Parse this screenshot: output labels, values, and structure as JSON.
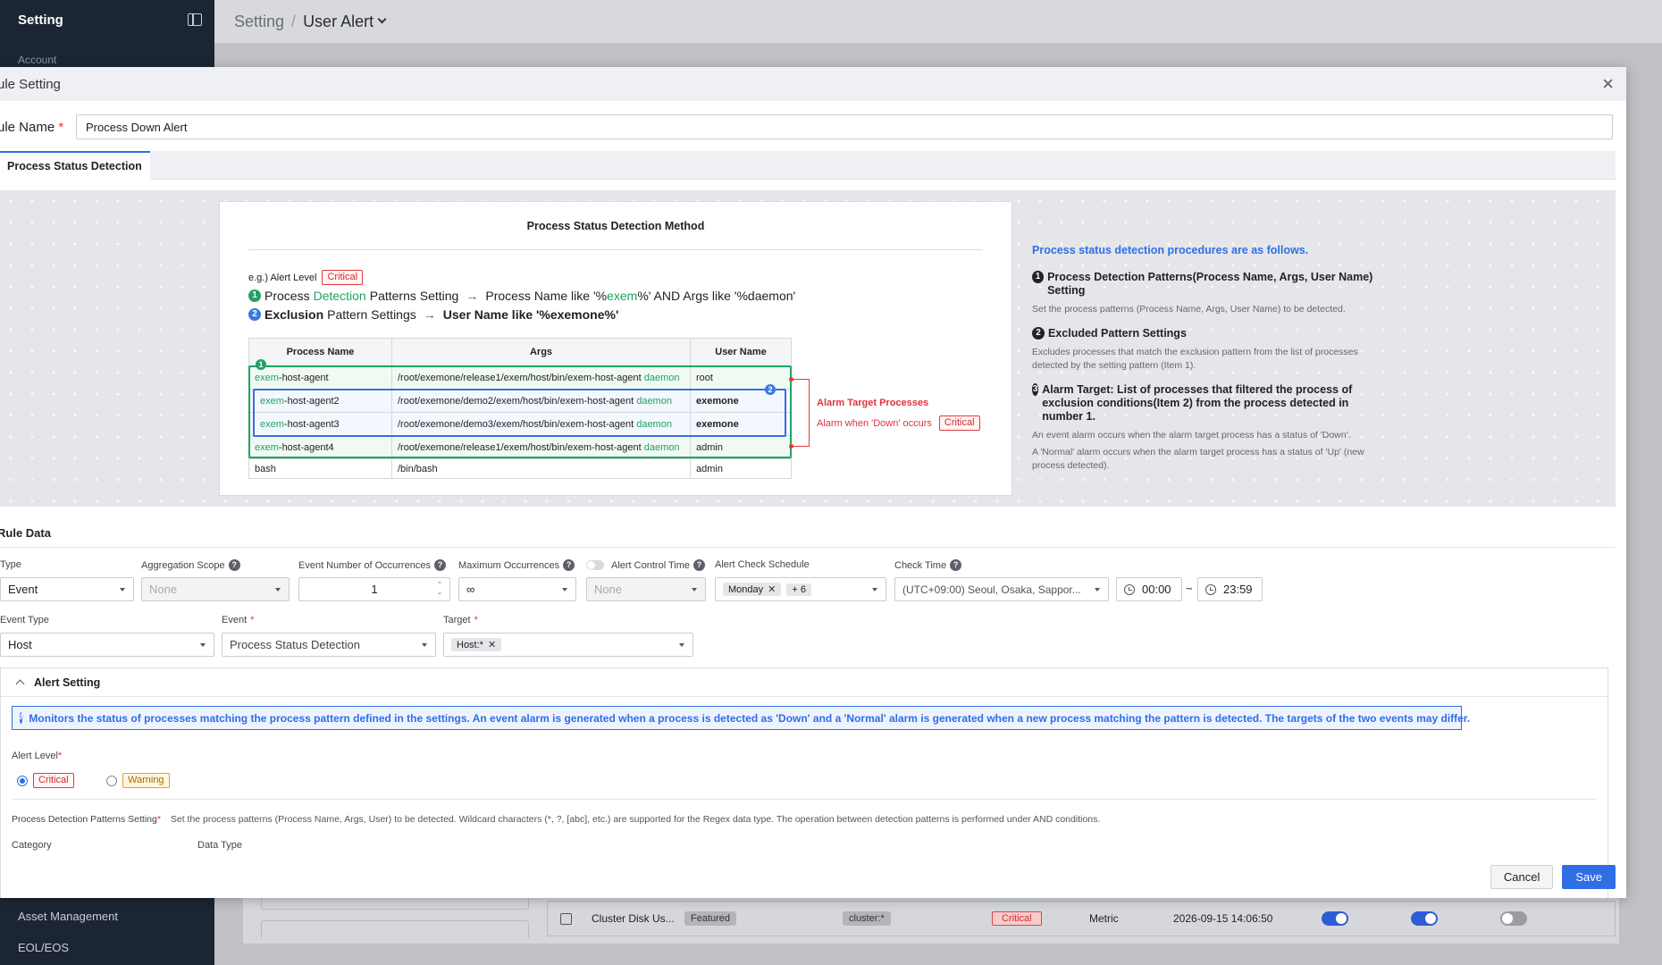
{
  "sidebar": {
    "title": "Setting",
    "account": "Account",
    "asset_management": "Asset Management",
    "eol": "EOL/EOS"
  },
  "topbar": {
    "breadcrumb1": "Setting",
    "sep": "/",
    "breadcrumb2": "User Alert"
  },
  "background_row": {
    "name": "Cluster Disk Us...",
    "featured": "Featured",
    "target": "cluster:*",
    "level": "Critical",
    "type": "Metric",
    "date": "2026-09-15 14:06:50"
  },
  "modal": {
    "title": "ule Setting",
    "rule_name_label": "ule Name",
    "rule_name_value": "Process Down Alert",
    "tab": "Process Status Detection",
    "illustration": {
      "card_title": "Process Status Detection Method",
      "eg_label": "e.g.) Alert Level",
      "critical": "Critical",
      "step1": {
        "num": "1",
        "a": "Process",
        "b": "Detection",
        "c": "Patterns Setting",
        "d": "Process Name like '%",
        "e": "exem",
        "f": "%' AND Args like '%daemon'"
      },
      "step2": {
        "num": "2",
        "a": "Exclusion",
        "b": "Pattern Settings",
        "c": "User Name like '%exemone%'"
      },
      "arrow": "→",
      "table_headers": [
        "Process Name",
        "Args",
        "User Name"
      ],
      "rows": [
        {
          "pre": "exem",
          "name": "-host-agent",
          "args": "/root/exemone/release1/exem/host/bin/exem-host-agent ",
          "daemon": "daemon",
          "user": "root"
        },
        {
          "pre": "exem",
          "name": "-host-agent2",
          "args": "/root/exemone/demo2/exem/host/bin/exem-host-agent ",
          "daemon": "daemon",
          "user": "exemone"
        },
        {
          "pre": "exem",
          "name": "-host-agent3",
          "args": "/root/exemone/demo3/exem/host/bin/exem-host-agent ",
          "daemon": "daemon",
          "user": "exemone"
        },
        {
          "pre": "exem",
          "name": "-host-agent4",
          "args": "/root/exemone/release1/exem/host/bin/exem-host-agent ",
          "daemon": "daemon",
          "user": "admin"
        },
        {
          "pre": "",
          "name": "bash",
          "args": "/bin/bash",
          "daemon": "",
          "user": "admin"
        }
      ],
      "marker1": "1",
      "marker2": "2",
      "alarm_target": "Alarm Target Processes",
      "alarm_when": "Alarm when 'Down' occurs",
      "procedures_title": "Process status detection procedures are as follows.",
      "procedures": [
        {
          "num": "1",
          "title": "Process Detection Patterns(Process Name, Args, User Name) Setting",
          "desc": "Set the process patterns (Process Name, Args, User Name) to be detected.",
          "desc2": ""
        },
        {
          "num": "2",
          "title": "Excluded Pattern Settings",
          "desc": "Excludes processes that match the exclusion pattern from the list of processes detected by the setting pattern (Item 1).",
          "desc2": ""
        },
        {
          "num": "3",
          "title": "Alarm Target: List of processes that filtered the process of exclusion conditions(Item 2) from the process detected in number 1.",
          "desc": "An event alarm occurs when the alarm target process has a status of 'Down'.",
          "desc2": "A 'Normal' alarm occurs when the alarm target process has a status of 'Up' (new process detected)."
        }
      ]
    },
    "rule_data": {
      "title": "Rule Data",
      "type_label": "Type",
      "type_value": "Event",
      "agg_label": "Aggregation Scope",
      "agg_value": "None",
      "occ_label": "Event Number of Occurrences",
      "occ_value": "1",
      "max_label": "Maximum Occurrences",
      "max_value": "∞",
      "act_label": "Alert Control Time",
      "act_value": "None",
      "sched_label": "Alert Check Schedule",
      "sched_chip": "Monday",
      "sched_more": "+ 6",
      "check_label": "Check Time",
      "check_tz": "(UTC+09:00) Seoul, Osaka, Sappor...",
      "time_from": "00:00",
      "tilde": "~",
      "time_to": "23:59",
      "etype_label": "Event Type",
      "etype_value": "Host",
      "event_label": "Event",
      "event_value": "Process Status Detection",
      "target_label": "Target",
      "target_chip": "Host:*",
      "q": "?"
    },
    "alert_setting": {
      "title": "Alert Setting",
      "info": "Monitors the status of processes matching the process pattern defined in the settings. An event alarm is generated when a process is detected as 'Down' and a 'Normal' alarm is generated when a new process matching the pattern is detected. The targets of the two events may differ.",
      "level_label": "Alert Level",
      "critical": "Critical",
      "warning": "Warning",
      "pdp_label": "Process Detection Patterns Setting",
      "pdp_desc": "Set the process patterns (Process Name, Args, User) to be detected. Wildcard characters (*, ?, [abc], etc.) are supported for the Regex data type. The operation between detection patterns is performed under AND conditions.",
      "category": "Category",
      "data_type": "Data Type"
    },
    "buttons": {
      "cancel": "Cancel",
      "save": "Save"
    },
    "req": "*"
  },
  "colors": {
    "accent": "#2f6ee5",
    "green": "#1fa363",
    "critical": "#e0323c"
  }
}
